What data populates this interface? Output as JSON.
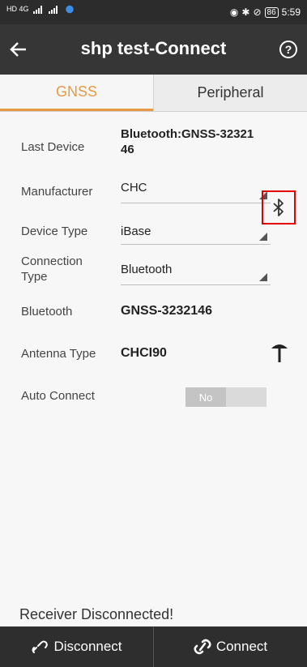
{
  "status_bar": {
    "left_text": "HD 4G",
    "battery": "86",
    "time": "5:59"
  },
  "app_bar": {
    "title": "shp test-Connect",
    "help_label": "?"
  },
  "tabs": [
    {
      "label": "GNSS",
      "active": true
    },
    {
      "label": "Peripheral",
      "active": false
    }
  ],
  "form": {
    "last_device": {
      "label": "Last Device",
      "value_line1": "Bluetooth:GNSS-32321",
      "value_line2": "46"
    },
    "manufacturer": {
      "label": "Manufacturer",
      "value": "CHC"
    },
    "device_type": {
      "label": "Device Type",
      "value": "iBase"
    },
    "connection_type": {
      "label_line1": "Connection",
      "label_line2": "Type",
      "value": "Bluetooth"
    },
    "bluetooth": {
      "label": "Bluetooth",
      "value": "GNSS-3232146",
      "icon": "bluetooth-icon"
    },
    "antenna_type": {
      "label": "Antenna Type",
      "value": "CHCI90",
      "icon": "antenna-icon"
    },
    "auto_connect": {
      "label": "Auto Connect",
      "value": "No"
    }
  },
  "status_message": "Receiver Disconnected!",
  "bottom": {
    "disconnect_label": "Disconnect",
    "connect_label": "Connect"
  },
  "colors": {
    "accent": "#e69a46",
    "highlight_border": "#e00000",
    "app_bar": "#363636"
  }
}
